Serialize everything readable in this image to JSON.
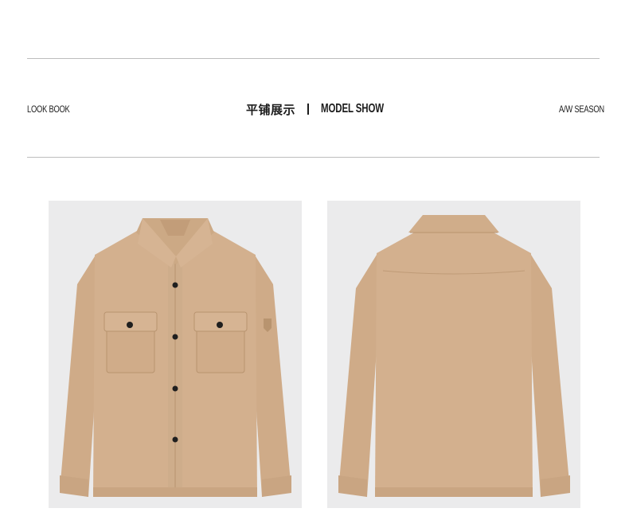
{
  "header": {
    "left_label": "LOOK BOOK",
    "center_cn": "平铺展示",
    "center_en": "MODEL SHOW",
    "right_label": "A/W SEASON"
  },
  "colors": {
    "shirt": "#d3b08e",
    "shirt_shadow": "#c4a07e",
    "photo_bg": "#ebebec",
    "button": "#1f1f1f",
    "rule": "#bdbdbd"
  },
  "gallery": {
    "items": [
      {
        "view": "front",
        "icon": "shirt-front-image"
      },
      {
        "view": "back",
        "icon": "shirt-back-image"
      }
    ]
  }
}
